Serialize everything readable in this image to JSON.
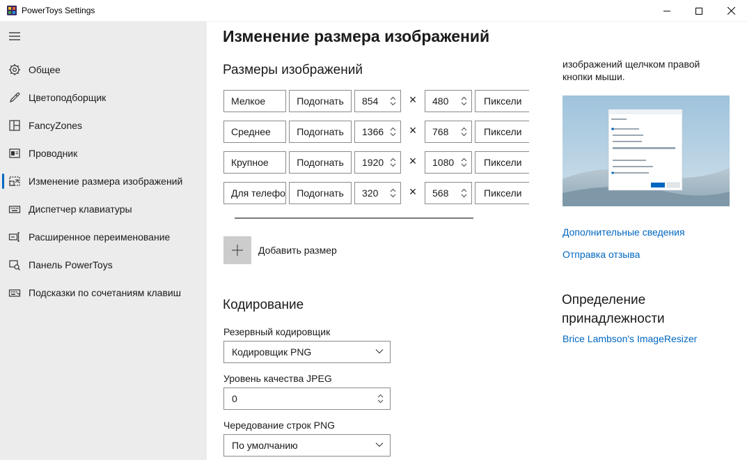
{
  "window": {
    "title": "PowerToys Settings",
    "icon": "powertoys-icon"
  },
  "sidebar": {
    "items": [
      {
        "label": "Общее",
        "icon": "gear-icon"
      },
      {
        "label": "Цветоподборщик",
        "icon": "eyedropper-icon"
      },
      {
        "label": "FancyZones",
        "icon": "zones-icon"
      },
      {
        "label": "Проводник",
        "icon": "explorer-icon"
      },
      {
        "label": "Изменение размера изображений",
        "icon": "image-resize-icon",
        "active": true
      },
      {
        "label": "Диспетчер клавиатуры",
        "icon": "keyboard-icon"
      },
      {
        "label": "Расширенное переименование",
        "icon": "rename-icon"
      },
      {
        "label": "Панель PowerToys",
        "icon": "run-icon"
      },
      {
        "label": "Подсказки по сочетаниям клавиш",
        "icon": "shortcut-guide-icon"
      }
    ]
  },
  "main": {
    "title": "Изменение размера изображений",
    "sizes_heading": "Размеры изображений",
    "times_sign": "×",
    "sizes": [
      {
        "name": "Мелкое",
        "fit": "Подогнать",
        "width": "854",
        "height": "480",
        "unit": "Пиксели"
      },
      {
        "name": "Среднее",
        "fit": "Подогнать",
        "width": "1366",
        "height": "768",
        "unit": "Пиксели"
      },
      {
        "name": "Крупное",
        "fit": "Подогнать",
        "width": "1920",
        "height": "1080",
        "unit": "Пиксели"
      },
      {
        "name": "Для телефо",
        "fit": "Подогнать",
        "width": "320",
        "height": "568",
        "unit": "Пиксели"
      }
    ],
    "add_size_label": "Добавить размер",
    "encoding_heading": "Кодирование",
    "fallback_encoder_label": "Резервный кодировщик",
    "fallback_encoder_value": "Кодировщик PNG",
    "jpeg_quality_label": "Уровень качества JPEG",
    "jpeg_quality_value": "0",
    "png_interlace_label": "Чередование строк PNG",
    "png_interlace_value": "По умолчанию"
  },
  "aside": {
    "description_tail": "изображений щелчком правой кнопки мыши.",
    "link_more": "Дополнительные сведения",
    "link_feedback": "Отправка отзыва",
    "attribution_heading": "Определение принадлежности",
    "attribution_link": "Brice Lambson's ImageResizer"
  },
  "colors": {
    "accent": "#0067c0",
    "sidebar_bg": "#ececec"
  }
}
